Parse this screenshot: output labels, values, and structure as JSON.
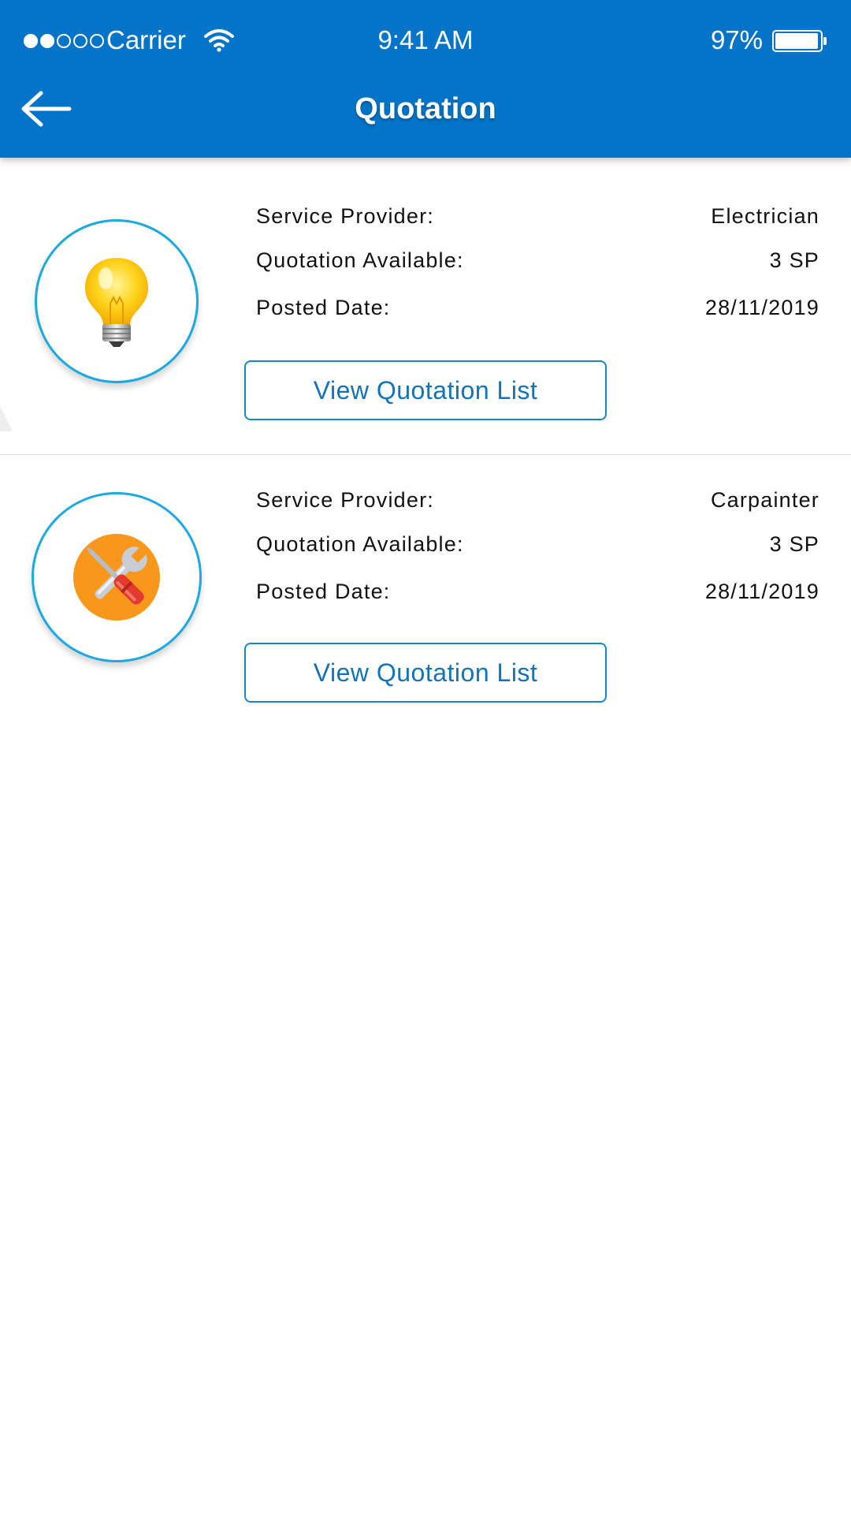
{
  "status_bar": {
    "carrier": "Carrier",
    "time": "9:41 AM",
    "battery_percent": "97%",
    "battery_level": 0.97,
    "signal_bars_filled": 2,
    "signal_bars_total": 5
  },
  "header": {
    "title": "Quotation",
    "back_icon": "arrow-left-icon",
    "background_color": "#0374c8"
  },
  "quotations": [
    {
      "icon": "light-bulb-icon",
      "service_provider_label": "Service Provider:",
      "service_provider_value": "Electrician",
      "quotation_available_label": "Quotation Available:",
      "quotation_available_value": "3 SP",
      "posted_date_label": "Posted Date:",
      "posted_date_value": "28/11/2019",
      "button_label": "View Quotation List"
    },
    {
      "icon": "wrench-screwdriver-icon",
      "service_provider_label": "Service Provider:",
      "service_provider_value": "Carpainter",
      "quotation_available_label": "Quotation Available:",
      "quotation_available_value": "3 SP",
      "posted_date_label": "Posted Date:",
      "posted_date_value": "28/11/2019",
      "button_label": "View Quotation List"
    }
  ],
  "colors": {
    "accent": "#1ca9e1",
    "button_text": "#1273b8",
    "tools_circle": "#f7981d"
  }
}
